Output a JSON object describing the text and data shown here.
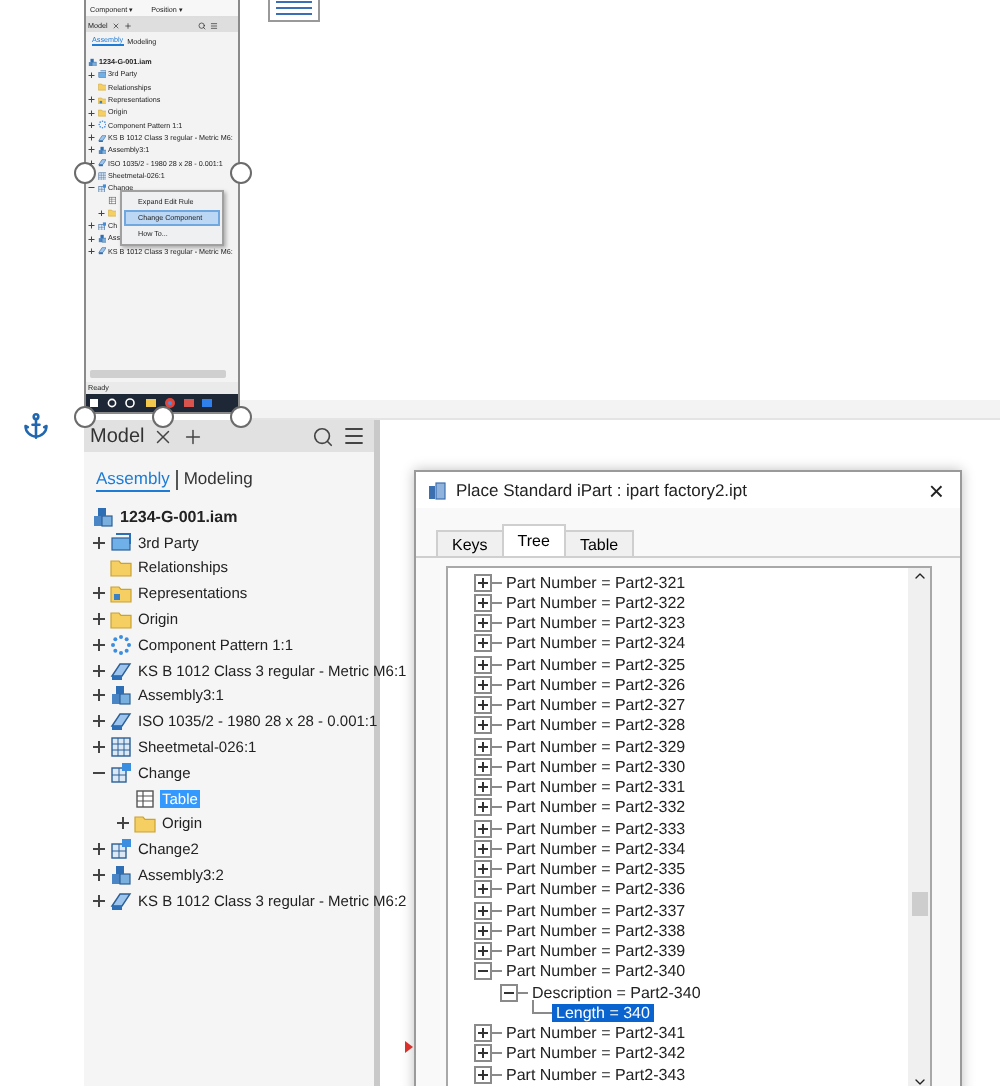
{
  "inset_screenshot": {
    "ribbon": [
      "Component ▾",
      "Position ▾"
    ],
    "tab": "Model",
    "modes": [
      {
        "label": "Assembly",
        "selected": true
      },
      {
        "label": "Modeling",
        "selected": false
      }
    ],
    "root": {
      "label": "1234-G-001.iam",
      "kind": "assembly"
    },
    "rows": [
      {
        "label": "3rd Party",
        "kind": "third-party",
        "expanded": false
      },
      {
        "label": "Relationships",
        "kind": "folder"
      },
      {
        "label": "Representations",
        "kind": "representations",
        "expanded": false
      },
      {
        "label": "Origin",
        "kind": "folder",
        "expanded": false
      },
      {
        "label": "Component Pattern 1:1",
        "kind": "pattern",
        "expanded": false
      },
      {
        "label": "KS B 1012 Class 3 regular - Metric M6:",
        "kind": "fastener",
        "expanded": false
      },
      {
        "label": "Assembly3:1",
        "kind": "assembly",
        "expanded": false
      },
      {
        "label": "ISO 1035/2 - 1980 28 x 28 - 0.001:1",
        "kind": "fastener",
        "expanded": false
      },
      {
        "label": "Sheetmetal-026:1",
        "kind": "sheetmetal"
      },
      {
        "label": "Change",
        "kind": "factory",
        "expanded": true,
        "children": [
          {
            "kind": "table"
          },
          {
            "kind": "folder",
            "expanded": false
          }
        ]
      },
      {
        "label": "Ch",
        "kind": "factory",
        "expanded": false
      },
      {
        "label": "Ass",
        "kind": "assembly",
        "expanded": false
      },
      {
        "label": "KS B 1012 Class 3 regular - Metric M6:",
        "kind": "fastener",
        "expanded": false
      }
    ],
    "context_menu": [
      {
        "label": "Expand Edit Rule",
        "selected": false
      },
      {
        "label": "Change Component",
        "selected": true
      },
      {
        "label": "How To...",
        "selected": false
      }
    ],
    "status": "Ready"
  },
  "browser": {
    "tab": "Model",
    "modes": [
      {
        "label": "Assembly",
        "selected": true
      },
      {
        "label": "Modeling",
        "selected": false
      }
    ],
    "root": {
      "label": "1234-G-001.iam",
      "kind": "assembly"
    },
    "tree": [
      {
        "label": "3rd Party",
        "kind": "third-party",
        "expanded": false,
        "selected": false
      },
      {
        "label": "Relationships",
        "kind": "folder",
        "selected": false
      },
      {
        "label": "Representations",
        "kind": "representations",
        "expanded": false,
        "selected": false
      },
      {
        "label": "Origin",
        "kind": "folder",
        "expanded": false,
        "selected": false
      },
      {
        "label": "Component Pattern 1:1",
        "kind": "pattern",
        "expanded": false,
        "selected": false
      },
      {
        "label": "KS B 1012 Class 3 regular - Metric M6:1",
        "kind": "fastener",
        "expanded": false,
        "selected": false
      },
      {
        "label": "Assembly3:1",
        "kind": "assembly",
        "expanded": false,
        "selected": false
      },
      {
        "label": "ISO 1035/2 - 1980 28 x 28 - 0.001:1",
        "kind": "fastener",
        "expanded": false,
        "selected": false
      },
      {
        "label": "Sheetmetal-026:1",
        "kind": "sheetmetal",
        "expanded": false,
        "selected": false
      },
      {
        "label": "Change",
        "kind": "factory",
        "expanded": true,
        "selected": false,
        "children": [
          {
            "label": "Table",
            "kind": "table",
            "selected": true
          },
          {
            "label": "Origin",
            "kind": "folder",
            "expanded": false,
            "selected": false
          }
        ]
      },
      {
        "label": "Change2",
        "kind": "factory",
        "expanded": false,
        "selected": false
      },
      {
        "label": "Assembly3:2",
        "kind": "assembly",
        "expanded": false,
        "selected": false
      },
      {
        "label": "KS B 1012 Class 3 regular - Metric M6:2",
        "kind": "fastener",
        "expanded": false,
        "selected": false
      }
    ]
  },
  "dialog": {
    "title": "Place Standard iPart : ipart factory2.ipt",
    "close": "×",
    "tabs": [
      {
        "label": "Keys",
        "selected": false
      },
      {
        "label": "Tree",
        "selected": true
      },
      {
        "label": "Table",
        "selected": false
      }
    ],
    "tree": [
      {
        "label": "Part Number = Part2-321",
        "expanded": false,
        "selected": false
      },
      {
        "label": "Part Number = Part2-322",
        "expanded": false,
        "selected": false
      },
      {
        "label": "Part Number = Part2-323",
        "expanded": false,
        "selected": false
      },
      {
        "label": "Part Number = Part2-324",
        "expanded": false,
        "selected": false
      },
      {
        "label": "Part Number = Part2-325",
        "expanded": false,
        "selected": false
      },
      {
        "label": "Part Number = Part2-326",
        "expanded": false,
        "selected": false
      },
      {
        "label": "Part Number = Part2-327",
        "expanded": false,
        "selected": false
      },
      {
        "label": "Part Number = Part2-328",
        "expanded": false,
        "selected": false
      },
      {
        "label": "Part Number = Part2-329",
        "expanded": false,
        "selected": false
      },
      {
        "label": "Part Number = Part2-330",
        "expanded": false,
        "selected": false
      },
      {
        "label": "Part Number = Part2-331",
        "expanded": false,
        "selected": false
      },
      {
        "label": "Part Number = Part2-332",
        "expanded": false,
        "selected": false
      },
      {
        "label": "Part Number = Part2-333",
        "expanded": false,
        "selected": false
      },
      {
        "label": "Part Number = Part2-334",
        "expanded": false,
        "selected": false
      },
      {
        "label": "Part Number = Part2-335",
        "expanded": false,
        "selected": false
      },
      {
        "label": "Part Number = Part2-336",
        "expanded": false,
        "selected": false
      },
      {
        "label": "Part Number = Part2-337",
        "expanded": false,
        "selected": false
      },
      {
        "label": "Part Number = Part2-338",
        "expanded": false,
        "selected": false
      },
      {
        "label": "Part Number = Part2-339",
        "expanded": false,
        "selected": false
      },
      {
        "label": "Part Number = Part2-340",
        "expanded": true,
        "selected": false,
        "children": [
          {
            "label": "Description = Part2-340",
            "expanded": true,
            "selected": false,
            "children": [
              {
                "label": "Length = 340",
                "selected": true
              }
            ]
          }
        ]
      },
      {
        "label": "Part Number = Part2-341",
        "expanded": false,
        "selected": false
      },
      {
        "label": "Part Number = Part2-342",
        "expanded": false,
        "selected": false
      },
      {
        "label": "Part Number = Part2-343",
        "expanded": false,
        "selected": false
      }
    ]
  }
}
